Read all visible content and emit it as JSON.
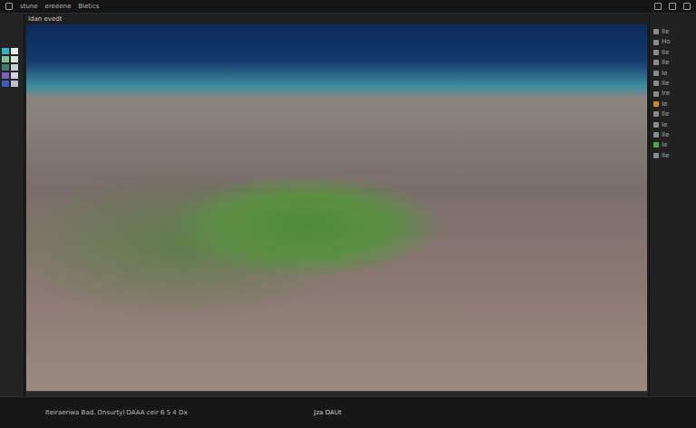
{
  "menu_bar": {
    "items": [
      "stune",
      "ereeene",
      "Bletics"
    ]
  },
  "viewport": {
    "title": "Idan evedt"
  },
  "left_panel": {
    "swatches": [
      {
        "color": "#2fb8c4"
      },
      {
        "color": "#e8eef0"
      },
      {
        "color": "#7fbf9a"
      },
      {
        "color": "#d8e4e0"
      },
      {
        "color": "#3a7f6a"
      },
      {
        "color": "#c8d0d4"
      },
      {
        "color": "#7a5fb8"
      },
      {
        "color": "#d0d4e0"
      },
      {
        "color": "#3e58c0"
      },
      {
        "color": "#b8c0c8"
      }
    ]
  },
  "right_panel": {
    "items": [
      {
        "label": "Ile",
        "color": "#8a8a8a"
      },
      {
        "label": "Ho",
        "color": "#8a8a8a"
      },
      {
        "label": "Ile",
        "color": "#8a8a8a"
      },
      {
        "label": "Ile",
        "color": "#8a8a8a"
      },
      {
        "label": "Ie",
        "color": "#8a8a8a"
      },
      {
        "label": "Ile",
        "color": "#8a8a8a"
      },
      {
        "label": "Ire",
        "color": "#8a8a8a"
      },
      {
        "label": "Ie",
        "color": "#d08a1a"
      },
      {
        "label": "Ile",
        "color": "#8a8a8a"
      },
      {
        "label": "Ie",
        "color": "#8a8a8a"
      },
      {
        "label": "Ile",
        "color": "#8a8a8a"
      },
      {
        "label": "Ie",
        "color": "#3fae3f"
      },
      {
        "label": "Ile",
        "color": "#8a8a8a"
      }
    ]
  },
  "status_bar": {
    "text": "Iteiraeriwa Bad. Onsurtyl DAAA ceir 6 5 4 Dx",
    "center": "Jza DAUt"
  }
}
